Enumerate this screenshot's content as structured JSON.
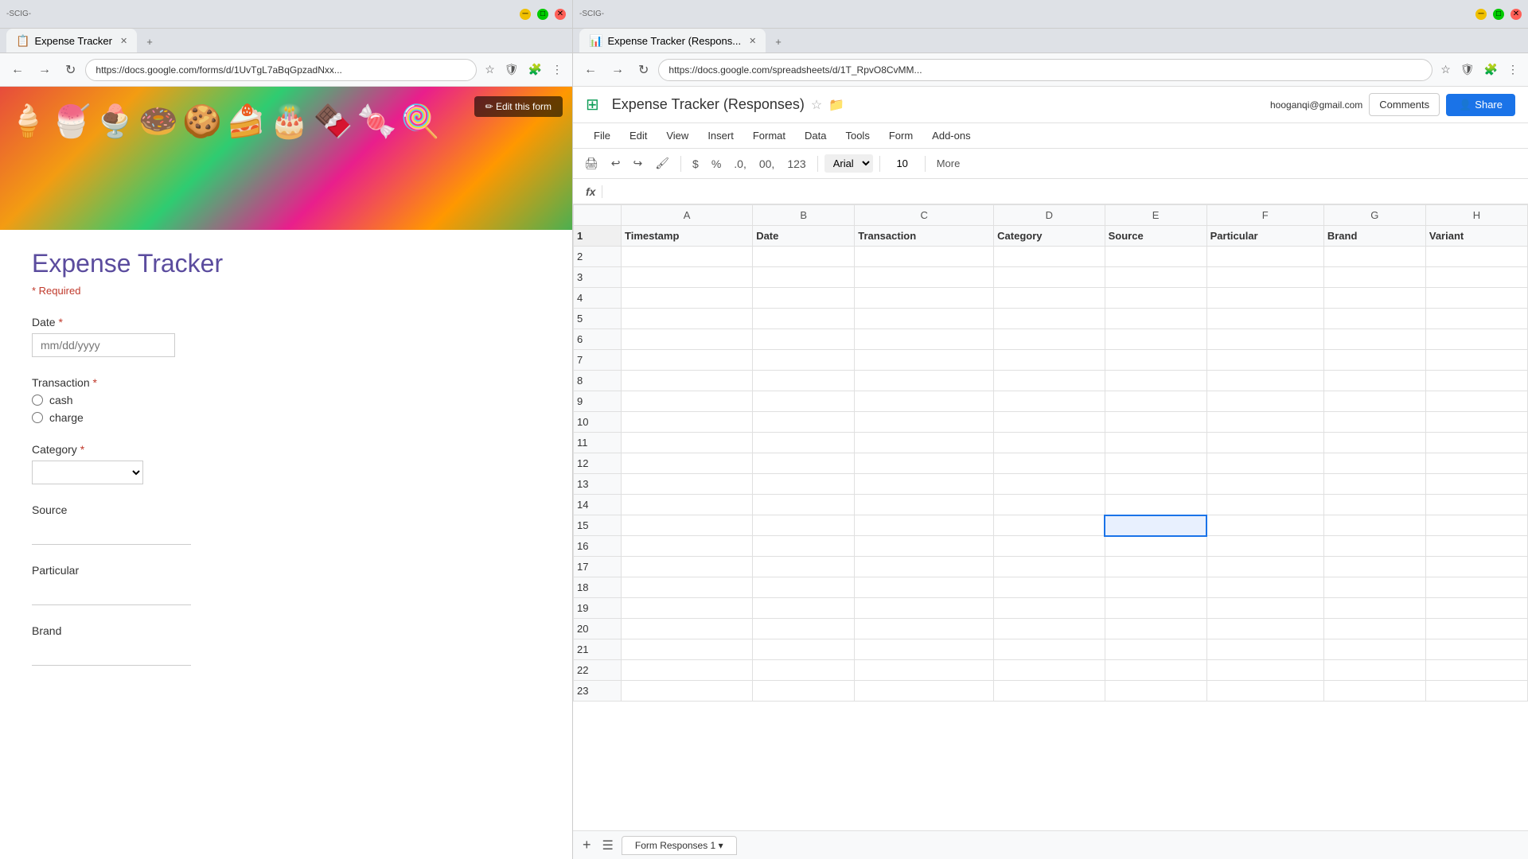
{
  "left_window": {
    "title": "Expense Tracker",
    "tab_label": "Expense Tracker",
    "address": "https://docs.google.com/forms/d/1UvTgL7aBqGpzadNxx...",
    "edit_form_btn": "✏ Edit this form",
    "form": {
      "title": "Expense Tracker",
      "required_note": "* Required",
      "fields": {
        "date": {
          "label": "Date",
          "required": true,
          "placeholder": "mm/dd/yyyy"
        },
        "transaction": {
          "label": "Transaction",
          "required": true,
          "options": [
            "cash",
            "charge"
          ]
        },
        "category": {
          "label": "Category",
          "required": true
        },
        "source": {
          "label": "Source",
          "required": false
        },
        "particular": {
          "label": "Particular",
          "required": false
        },
        "brand": {
          "label": "Brand",
          "required": false
        }
      }
    }
  },
  "right_window": {
    "title": "Expense Tracker (Responses)",
    "tab_label": "Expense Tracker (Respons...",
    "address": "https://docs.google.com/spreadsheets/d/1T_RpvO8CvMM...",
    "user_email": "hooganqi@gmail.com",
    "share_btn": "Share",
    "comments_btn": "Comments",
    "spreadsheet": {
      "title": "Expense Tracker (Responses)",
      "menu": [
        "File",
        "Edit",
        "View",
        "Insert",
        "Format",
        "Data",
        "Tools",
        "Form",
        "Add-ons"
      ],
      "toolbar": {
        "currency_symbol": "$",
        "percent_symbol": "%",
        "decimal_decrease": ".0,",
        "decimal_increase": "00,",
        "font_format": "123",
        "font_family": "Arial",
        "font_size": "10",
        "more_btn": "More"
      },
      "columns": [
        "Timestamp",
        "Date",
        "Transaction",
        "Category",
        "Source",
        "Particular",
        "Brand",
        "Variant"
      ],
      "column_letters": [
        "A",
        "B",
        "C",
        "D",
        "E",
        "F",
        "G",
        "H"
      ],
      "rows": 23,
      "selected_cell": {
        "row": 15,
        "col": "E"
      },
      "sheet_tabs": [
        "Form Responses 1"
      ]
    }
  }
}
